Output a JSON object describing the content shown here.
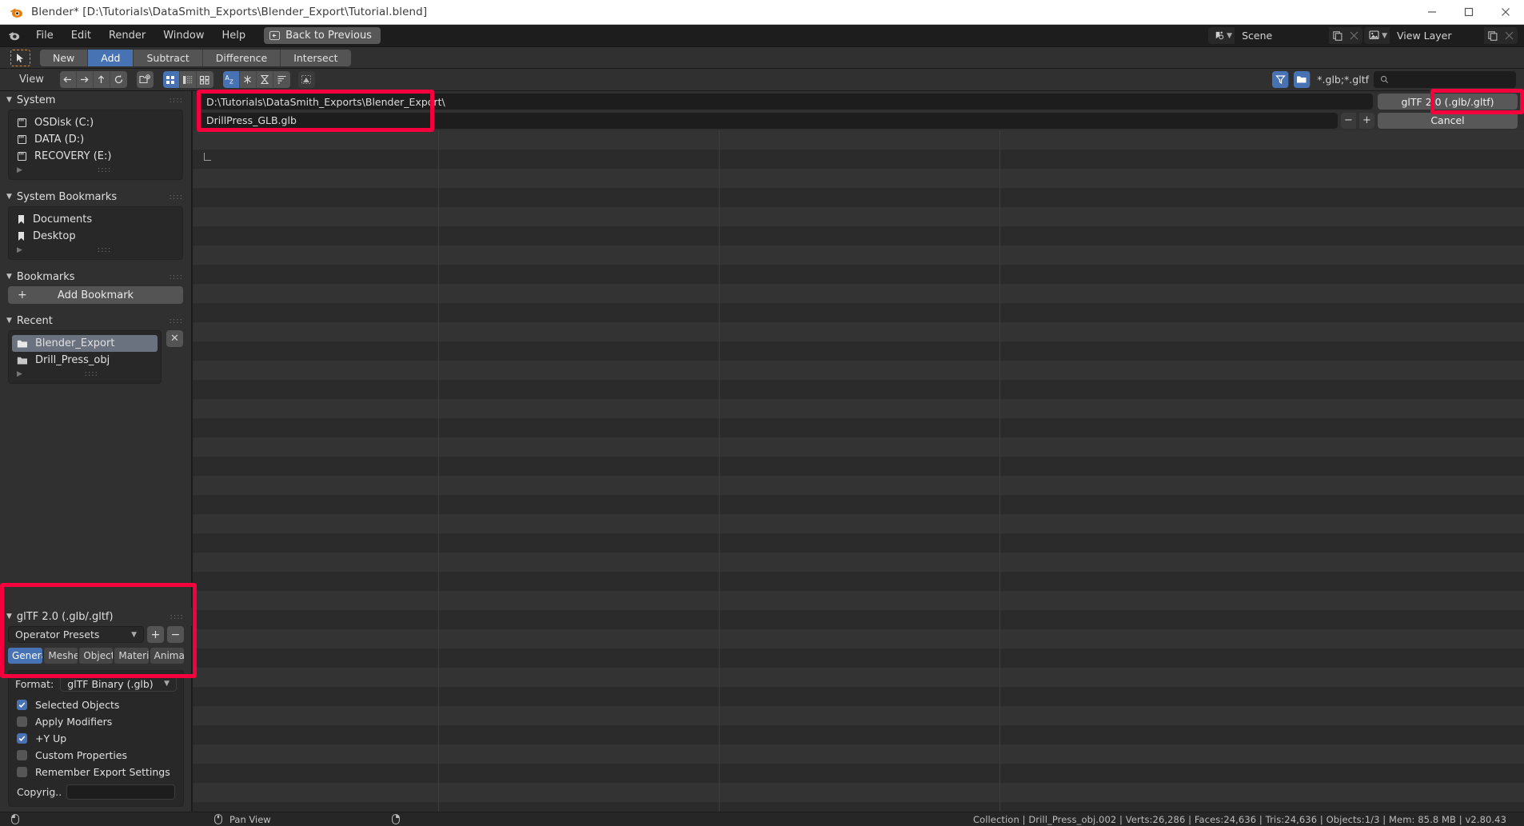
{
  "window": {
    "title": "Blender* [D:\\Tutorials\\DataSmith_Exports\\Blender_Export\\Tutorial.blend]",
    "logo": "blender-logo",
    "minimize": "—",
    "maximize": "□",
    "close": "✕"
  },
  "topbar": {
    "menus": [
      "File",
      "Edit",
      "Render",
      "Window",
      "Help"
    ],
    "back_to_previous": "Back to Previous",
    "scene": {
      "label": "Scene",
      "icon": "scene-icon"
    },
    "view_layer": {
      "label": "View Layer",
      "icon": "view-layer-icon"
    }
  },
  "select_mode": {
    "cursor_icon": "tweak-cursor-icon",
    "modes": [
      {
        "label": "New",
        "active": false
      },
      {
        "label": "Add",
        "active": true
      },
      {
        "label": "Subtract",
        "active": false
      },
      {
        "label": "Difference",
        "active": false
      },
      {
        "label": "Intersect",
        "active": false
      }
    ]
  },
  "file_header": {
    "view_menu": "View",
    "nav_icons": [
      "back-arrow-icon",
      "forward-arrow-icon",
      "up-arrow-icon",
      "refresh-icon"
    ],
    "new_folder_icon": "new-folder-icon",
    "display_modes": [
      "vertical-list-icon",
      "horizontal-list-icon",
      "thumbnail-grid-icon"
    ],
    "sort_icons": [
      "sort-alpha-icon",
      "sort-extension-icon",
      "sort-time-icon",
      "sort-size-icon"
    ],
    "filter_toggle_icon": "filter-funnel-icon",
    "folder_filter_icon": "folder-filter-icon",
    "filter_value": "*.glb;*.gltf",
    "search_placeholder": "",
    "search_icon": "search-icon"
  },
  "sidebar": {
    "system": {
      "title": "System",
      "items": [
        {
          "label": "OSDisk (C:)",
          "icon": "drive-icon"
        },
        {
          "label": "DATA (D:)",
          "icon": "drive-icon"
        },
        {
          "label": "RECOVERY (E:)",
          "icon": "drive-icon"
        }
      ]
    },
    "system_bookmarks": {
      "title": "System Bookmarks",
      "items": [
        {
          "label": "Documents",
          "icon": "bookmark-icon"
        },
        {
          "label": "Desktop",
          "icon": "bookmark-icon"
        }
      ]
    },
    "bookmarks": {
      "title": "Bookmarks",
      "add_label": "Add Bookmark",
      "add_icon": "plus-icon"
    },
    "recent": {
      "title": "Recent",
      "clear_icon": "close-icon",
      "items": [
        {
          "label": "Blender_Export",
          "icon": "folder-icon",
          "selected": true
        },
        {
          "label": "Drill_Press_obj",
          "icon": "folder-icon",
          "selected": false
        }
      ]
    }
  },
  "operator_panel": {
    "title": "glTF 2.0 (.glb/.gltf)",
    "preset": "Operator Presets",
    "preset_add": "+",
    "preset_remove": "−",
    "tabs": [
      {
        "label": "General",
        "active": true
      },
      {
        "label": "Meshes",
        "active": false
      },
      {
        "label": "Objects",
        "active": false
      },
      {
        "label": "Materi..",
        "active": false
      },
      {
        "label": "Anima..",
        "active": false
      }
    ],
    "format_label": "Format:",
    "format_value": "glTF Binary (.glb)",
    "options": [
      {
        "label": "Selected Objects",
        "checked": true
      },
      {
        "label": "Apply Modifiers",
        "checked": false
      },
      {
        "label": "+Y Up",
        "checked": true
      },
      {
        "label": "Custom Properties",
        "checked": false
      },
      {
        "label": "Remember Export Settings",
        "checked": false
      }
    ],
    "copyright_label": "Copyrig..",
    "copyright_value": ""
  },
  "file_dialog": {
    "path_value": "D:\\Tutorials\\DataSmith_Exports\\Blender_Export\\",
    "filename_value": "DrillPress_GLB.glb",
    "export_button": "glTF 2.0 (.glb/.gltf)",
    "cancel_button": "Cancel",
    "increment": "+",
    "decrement": "−"
  },
  "statusbar": {
    "left_mouse_icon": "mouse-left-icon",
    "middle_mouse_icon": "mouse-middle-icon",
    "right_mouse_icon": "mouse-right-icon",
    "pan_view": "Pan View",
    "info": "Collection | Drill_Press_obj.002 | Verts:26,286 | Faces:24,636 | Tris:24,636 | Objects:1/3 | Mem: 85.8 MB | v2.80.43"
  },
  "colors": {
    "accent_blue": "#4772b3",
    "annotation_red": "#f5003c",
    "panel_bg": "#303030",
    "field_bg": "#1d1d1d",
    "orange": "#e08b2c"
  }
}
